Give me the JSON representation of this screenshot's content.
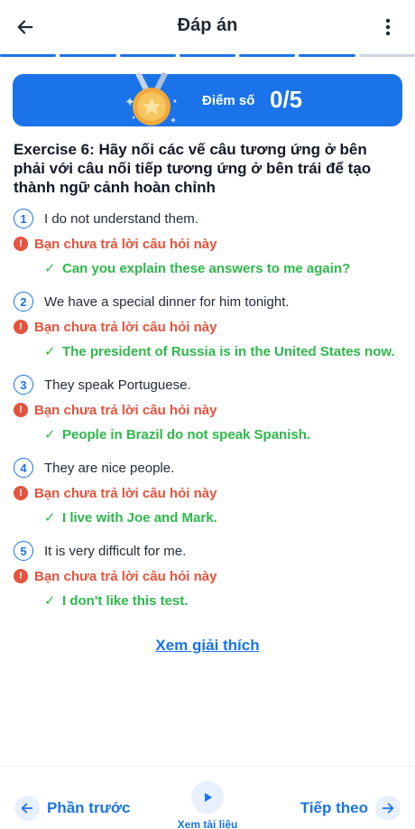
{
  "header": {
    "title": "Đáp án",
    "back_icon": "arrow-left-icon",
    "menu_icon": "more-vertical-icon"
  },
  "progress": {
    "completed_segments": 6,
    "total_segments": 7
  },
  "score": {
    "label": "Điểm số",
    "value": "0/5",
    "icon": "medal-icon"
  },
  "exercise": {
    "title": "Exercise 6: Hãy nối các vế câu tương ứng ở bên phải với câu nối tiếp tương ứng ở bên trái để tạo thành ngữ cảnh hoàn chỉnh"
  },
  "questions": [
    {
      "num": "1",
      "text": "I do not understand them.",
      "warning": "Bạn chưa trả lời câu hỏi này",
      "answer": "Can you explain these answers to me again?"
    },
    {
      "num": "2",
      "text": "We have a special dinner for him tonight.",
      "warning": "Bạn chưa trả lời câu hỏi này",
      "answer": "The president of Russia is in the United States now."
    },
    {
      "num": "3",
      "text": "They speak Portuguese.",
      "warning": "Bạn chưa trả lời câu hỏi này",
      "answer": "People in Brazil do not speak Spanish."
    },
    {
      "num": "4",
      "text": "They are nice people.",
      "warning": "Bạn chưa trả lời câu hỏi này",
      "answer": "I live with Joe and Mark."
    },
    {
      "num": "5",
      "text": "It is very difficult for me.",
      "warning": "Bạn chưa trả lời câu hỏi này",
      "answer": "I don't like this test."
    }
  ],
  "explain_link": "Xem giải thích",
  "footer": {
    "prev_label": "Phần trước",
    "doc_label": "Xem tài liệu",
    "next_label": "Tiếp theo"
  },
  "colors": {
    "primary": "#1a73e8",
    "error": "#e5533d",
    "success": "#2db84a"
  }
}
